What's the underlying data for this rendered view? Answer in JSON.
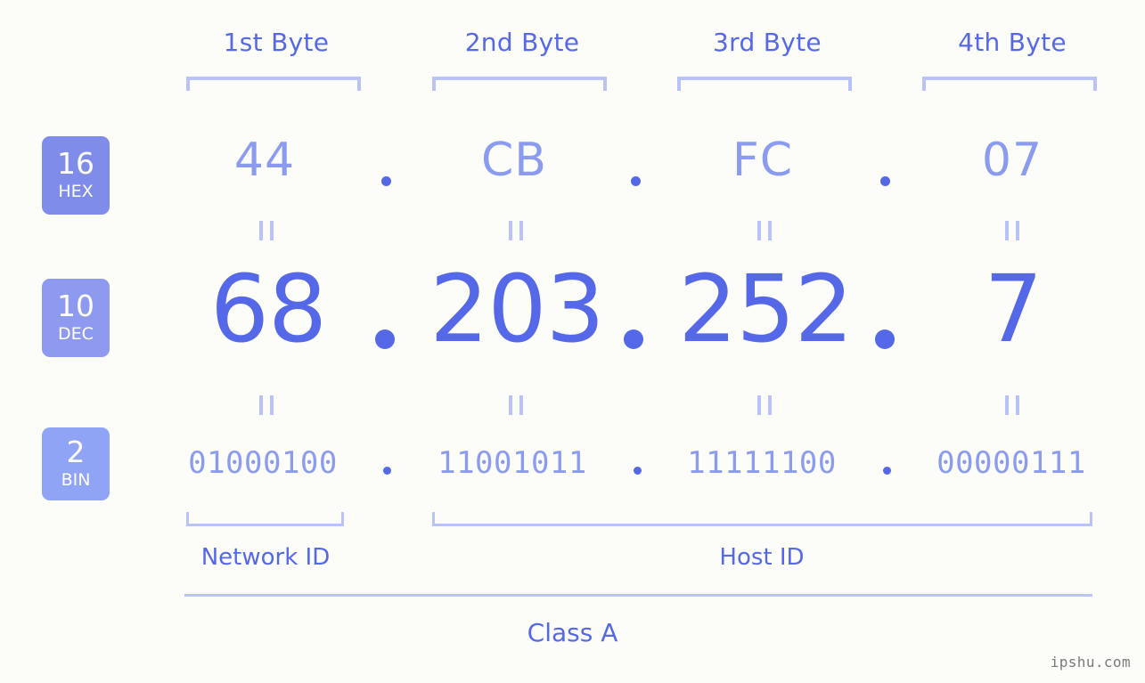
{
  "background_color": "#fcfdf8",
  "accent_color": "#5468e8",
  "accent_light_color": "#8b9bf0",
  "bracket_color": "#b9c3fa",
  "byte_headers": [
    {
      "label": "1st Byte"
    },
    {
      "label": "2nd Byte"
    },
    {
      "label": "3rd Byte"
    },
    {
      "label": "4th Byte"
    }
  ],
  "bases": [
    {
      "number": "16",
      "name": "HEX",
      "color": "#7f8ce9"
    },
    {
      "number": "10",
      "name": "DEC",
      "color": "#8e9af0"
    },
    {
      "number": "2",
      "name": "BIN",
      "color": "#8fa4f5"
    }
  ],
  "rows": {
    "hex": {
      "base_number": "16",
      "base_name": "HEX",
      "values": [
        "44",
        "CB",
        "FC",
        "07"
      ],
      "separator": "."
    },
    "dec": {
      "base_number": "10",
      "base_name": "DEC",
      "values": [
        "68",
        "203",
        "252",
        "7"
      ],
      "separator": "."
    },
    "bin": {
      "base_number": "2",
      "base_name": "BIN",
      "values": [
        "01000100",
        "11001011",
        "11111100",
        "00000111"
      ],
      "separator": "."
    }
  },
  "equivalence_marks": {
    "hex_to_dec": [
      "=",
      "=",
      "=",
      "="
    ],
    "dec_to_bin": [
      "=",
      "=",
      "=",
      "="
    ]
  },
  "sections": [
    {
      "label": "Network ID"
    },
    {
      "label": "Host ID"
    }
  ],
  "class_label": "Class A",
  "watermark": "ipshu.com"
}
